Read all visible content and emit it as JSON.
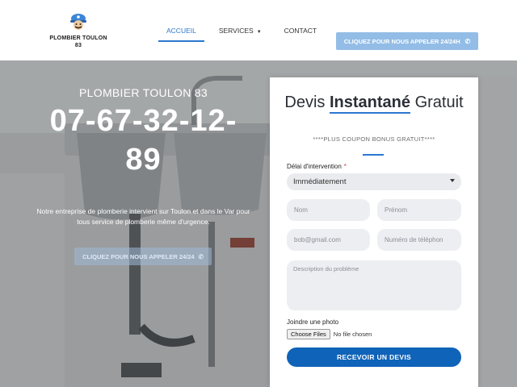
{
  "brand": {
    "name": "PLOMBIER TOULON 83"
  },
  "nav": {
    "items": [
      {
        "label": "ACCUEIL",
        "active": true
      },
      {
        "label": "SERVICES",
        "has_dropdown": true
      },
      {
        "label": "CONTACT"
      }
    ]
  },
  "header": {
    "cta_label": "CLIQUEZ POUR NOUS APPELER 24/24H",
    "cta_icon": "phone-icon"
  },
  "hero": {
    "tagline": "PLOMBIER TOULON 83",
    "phone": "07-67-32-12-89",
    "description": "Notre entreprise de plomberie intervient sur Toulon et dans le Var pour tous service de plomberie même d'urgence.",
    "cta_label": "CLIQUEZ POUR NOUS APPELER 24/24",
    "cta_icon": "phone-icon"
  },
  "form": {
    "title_part1": "Devis",
    "title_part2": "Instantané",
    "title_part3": "Gratuit",
    "coupon": "****PLUS COUPON BONUS GRATUIT****",
    "delay_label": "Délai d'intervention",
    "delay_required": "*",
    "delay_value": "Immédiatement",
    "name_placeholder": "Nom",
    "firstname_placeholder": "Prénom",
    "email_placeholder": "bob@gmail.com",
    "phone_placeholder": "Numéro de téléphon",
    "problem_placeholder": "Description du problème",
    "photo_label": "Joindre une photo",
    "file_button": "Choose Files",
    "file_status": "No file chosen",
    "submit_label": "RECEVOIR UN DEVIS"
  },
  "colors": {
    "accent": "#2a78d1",
    "submit": "#0f63b8",
    "cta_light": "#93bde6"
  }
}
